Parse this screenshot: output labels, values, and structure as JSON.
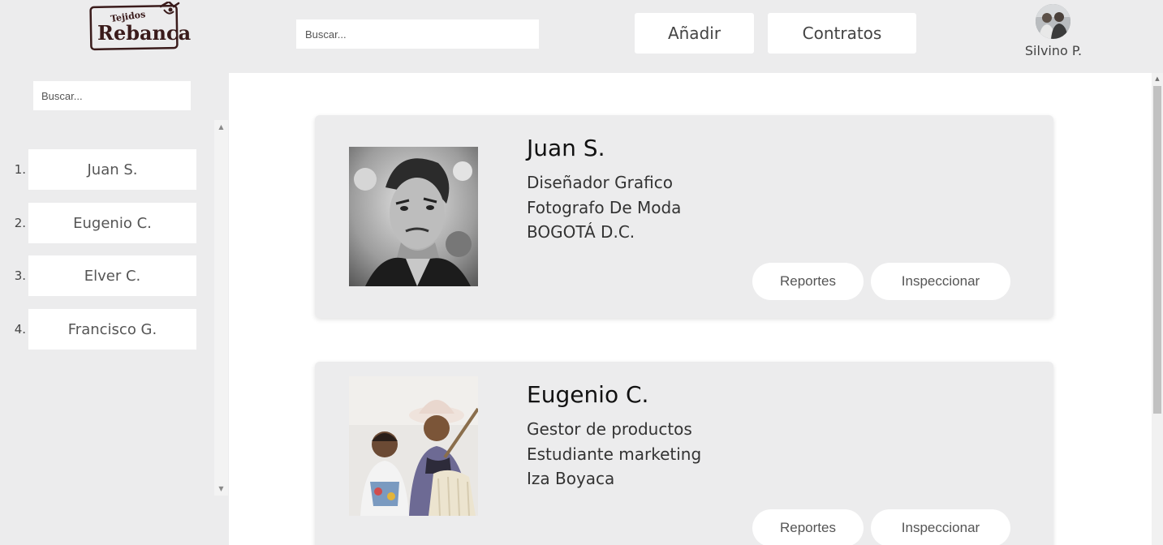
{
  "header": {
    "logo": {
      "line1": "Tejidos",
      "line2": "Rebanca"
    },
    "search_placeholder": "Buscar...",
    "add_label": "Añadir",
    "contracts_label": "Contratos",
    "user_name": "Silvino P."
  },
  "sidebar": {
    "search_placeholder": "Buscar...",
    "items": [
      {
        "num": "1.",
        "label": "Juan S."
      },
      {
        "num": "2.",
        "label": "Eugenio C."
      },
      {
        "num": "3.",
        "label": "Elver C."
      },
      {
        "num": "4.",
        "label": "Francisco G."
      }
    ]
  },
  "cards": [
    {
      "name": "Juan S.",
      "lines": [
        "Diseñador Grafico",
        "Fotografo De Moda",
        "BOGOTÁ D.C."
      ],
      "reports_label": "Reportes",
      "inspect_label": "Inspeccionar"
    },
    {
      "name": "Eugenio C.",
      "lines": [
        "Gestor de productos",
        "Estudiante marketing",
        "Iza Boyaca"
      ],
      "reports_label": "Reportes",
      "inspect_label": "Inspeccionar"
    }
  ],
  "colors": {
    "background": "#ececed",
    "panel": "#ffffff",
    "logo": "#3a1b1b"
  }
}
